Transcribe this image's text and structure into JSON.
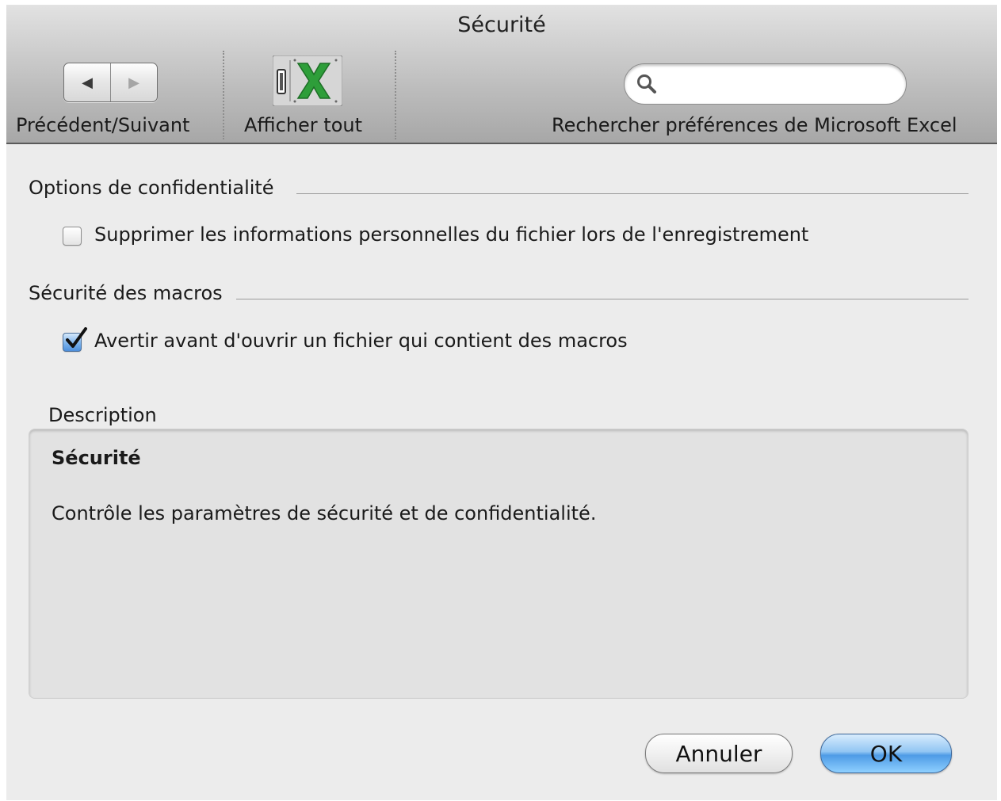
{
  "window": {
    "title": "Sécurité"
  },
  "toolbar": {
    "nav_label": "Précédent/Suivant",
    "back_icon": "arrow-left",
    "forward_icon": "arrow-right",
    "show_all_label": "Afficher tout",
    "search_label": "Rechercher préférences de Microsoft Excel",
    "search_value": "",
    "search_placeholder": ""
  },
  "privacy": {
    "header": "Options de confidentialité",
    "remove_personal_info": {
      "label": "Supprimer les informations personnelles du fichier lors de l'enregistrement",
      "checked": false
    }
  },
  "macros": {
    "header": "Sécurité des macros",
    "warn_before_open": {
      "label": "Avertir avant d'ouvrir un fichier qui contient des macros",
      "checked": true
    }
  },
  "description": {
    "title": "Description",
    "heading": "Sécurité",
    "text": "Contrôle les paramètres de sécurité et de confidentialité."
  },
  "buttons": {
    "cancel": "Annuler",
    "ok": "OK"
  },
  "colors": {
    "window_bg": "#ececec",
    "accent_blue": "#4e9be6",
    "excel_green": "#2e9e3a"
  }
}
